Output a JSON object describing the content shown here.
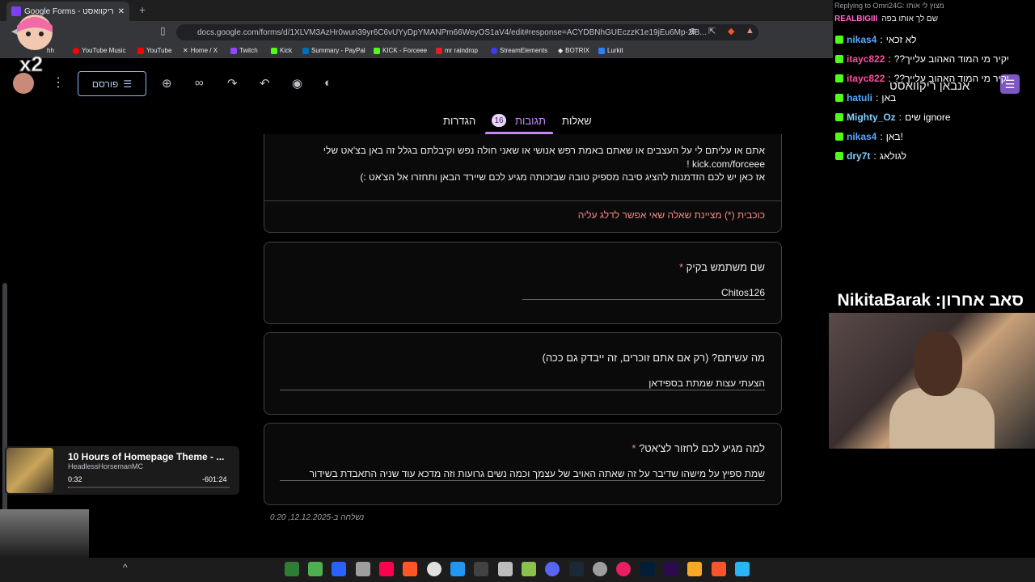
{
  "browser": {
    "tab_title": "Google Forms - אנבאן ריקוואסט",
    "new_tab": "+",
    "close": "✕",
    "url": "docs.google.com/forms/d/1XLVM3AzHr0wun39yr6C6vUYyDpYMANPm66WeyOS1aV4/edit#response=ACYDBNhGUEczzK1e19jEu6Mp-2lB...",
    "bookmarks": [
      {
        "label": "hh",
        "color": "#888888"
      },
      {
        "label": "YouTube Music",
        "color": "#ff0000"
      },
      {
        "label": "YouTube",
        "color": "#ff0000"
      },
      {
        "label": "Home / X",
        "color": "#ffffff"
      },
      {
        "label": "Twitch",
        "color": "#9146ff"
      },
      {
        "label": "Kick",
        "color": "#53fc18"
      },
      {
        "label": "Summary - PayPal",
        "color": "#0070ba"
      },
      {
        "label": "KICK - Forceee",
        "color": "#53fc18"
      },
      {
        "label": "mr raindrop",
        "color": "#e02020"
      },
      {
        "label": "StreamElements",
        "color": "#3b3bff"
      },
      {
        "label": "BOTRIX",
        "color": "#ffffff"
      },
      {
        "label": "Lurkit",
        "color": "#2d7ff9"
      }
    ]
  },
  "form_header": {
    "publish_label": "פורסם",
    "tabs": {
      "questions": "שאלות",
      "responses": "תגובות",
      "responses_count": "16",
      "settings": "הגדרות"
    }
  },
  "description": {
    "line1": "אתם או עליתם לי על העצבים או שאתם באמת רפש אנושי או שאני חולה נפש וקיבלתם בגלל זה באן בצ'אט שלי",
    "line2": "kick.com/forceee !",
    "line3": "אז כאן יש לכם הזדמנות להציג סיבה מספיק טובה שבזכותה מגיע לכם שיירד הבאן ותחזרו אל הצ'אט :)",
    "required_note": "כוכבית (*) מציינת שאלה שאי אפשר לדלג עליה"
  },
  "questions": [
    {
      "title": "שם משתמש בקיק",
      "required": "*",
      "answer": "Chitos126"
    },
    {
      "title": "מה עשיתם? (רק אם אתם זוכרים, זה ייבדק גם ככה)",
      "required": "",
      "answer": "הצעתי עצות שמתת בספידאן"
    },
    {
      "title": "למה מגיע לכם לחזור לצ'אט?",
      "required": "*",
      "answer": "שמת ספיץ על מישהו שדיבר על זה שאתה האויב של עצמך וכמה נשים גרועות וזה מדכא עוד שניה התאבדת בשידור"
    }
  ],
  "submitted": "נשלחה ב-12.12.2025, 0:20",
  "chat": {
    "replying_to": "Replying to Omri24G: מצוץ לי אותו",
    "reply_message": "שם לך אותו בפה",
    "reply_user": "REALBIGIII",
    "messages": [
      {
        "user": "nikas4",
        "color": "#5aa9ff",
        "text": "לא זכאי"
      },
      {
        "user": "itayc822",
        "color": "#ff4fa0",
        "text": "??יקיר מי המוד האהוב עלייך"
      },
      {
        "user": "itayc822",
        "color": "#ff4fa0",
        "text": "??יקיר מי המוד האהוב עלייך"
      },
      {
        "user": "hatuli",
        "color": "#5aa9ff",
        "text": "באן"
      },
      {
        "user": "Mighty_Oz",
        "color": "#7fd0ff",
        "text": "שים ignore"
      },
      {
        "user": "nikas4",
        "color": "#5aa9ff",
        "text": "באן!"
      },
      {
        "user": "dry7t",
        "color": "#7fd0ff",
        "text": "לגולאג"
      }
    ],
    "overlay_title": "אנבאן ריקוואסט",
    "latest_sub": "סאב אחרון: NikitaBarak"
  },
  "music": {
    "title": "10 Hours of Homepage Theme - ...",
    "artist": "HeadlessHorsemanMC",
    "elapsed": "0:32",
    "remaining": "-601:24",
    "progress": 0.001
  },
  "logo_text": "x2",
  "colors": {
    "accent": "#c58af9",
    "required": "#f28b82",
    "publish": "#8ab4f8"
  }
}
